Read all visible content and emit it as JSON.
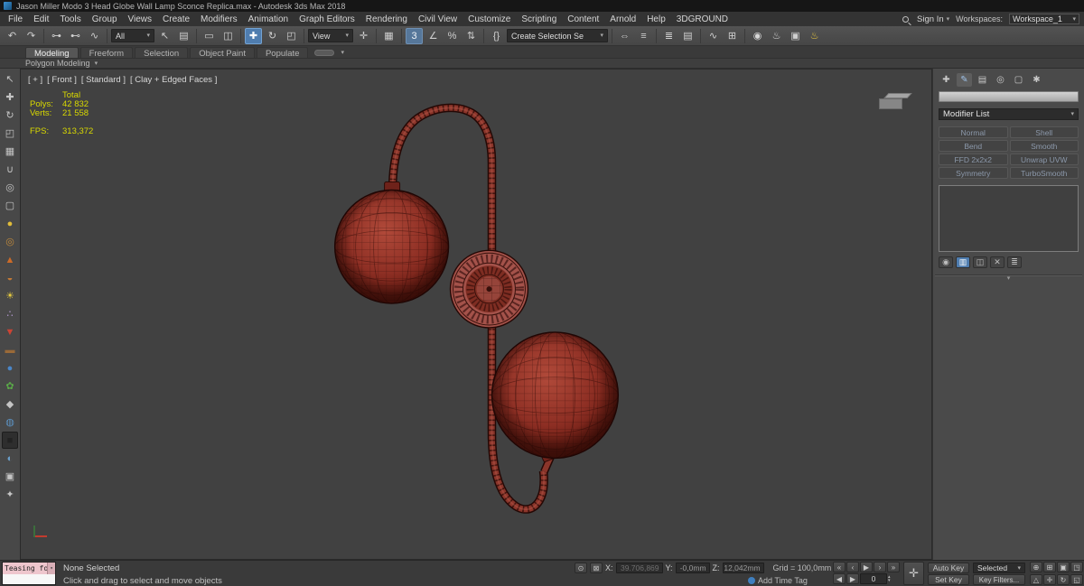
{
  "colors": {
    "accent_blue": "#4f7daf",
    "stats_yellow": "#d9d900",
    "globe_red": "#8a352a",
    "wire_dark": "#2a0906"
  },
  "title_bar": {
    "title": "Jason Miller Modo 3 Head Globe Wall Lamp Sconce Replica.max - Autodesk 3ds Max 2018"
  },
  "menu_bar": {
    "items": [
      "File",
      "Edit",
      "Tools",
      "Group",
      "Views",
      "Create",
      "Modifiers",
      "Animation",
      "Graph Editors",
      "Rendering",
      "Civil View",
      "Customize",
      "Scripting",
      "Content",
      "Arnold",
      "Help",
      "3DGROUND"
    ],
    "sign_in": "Sign In",
    "workspaces_label": "Workspaces:",
    "workspace_value": "Workspace_1"
  },
  "toolbar": {
    "filter_value": "All",
    "reference_value": "View",
    "named_sets_value": "Create Selection Se",
    "icons": {
      "undo": "↶",
      "redo": "↷",
      "link": "⊶",
      "unlink": "⊷",
      "bind": "∿",
      "select": "↖",
      "select_by_name": "▤",
      "region": "▭",
      "window_crossing": "◫",
      "move": "✚",
      "rotate": "↻",
      "scale": "◰",
      "manipulate": "✛",
      "keyboard": "▦",
      "snap": "3",
      "angle_snap": "∠",
      "percent_snap": "%",
      "spinner_snap": "⇅",
      "edit_sets": "{}",
      "mirror": "⇔",
      "align": "≡",
      "layers": "≣",
      "toggle_ribbon": "▤",
      "curve_editor": "∿",
      "schematic": "⊞",
      "material": "◉",
      "render_setup": "♨",
      "frame_window": "▣",
      "render": "♨"
    }
  },
  "ribbon": {
    "tabs": [
      "Modeling",
      "Freeform",
      "Selection",
      "Object Paint",
      "Populate"
    ],
    "panel_label": "Polygon Modeling"
  },
  "left_toolbar": {
    "icons": {
      "select": "↖",
      "move": "✚",
      "rotate": "↻",
      "scale": "◰",
      "grid": "▦",
      "magnet": "∪",
      "pivot": "◎",
      "box": "▢",
      "sphere": "●",
      "torus": "◎",
      "cone": "▲",
      "cup": "◒",
      "sun": "☀",
      "particles": "∴",
      "drop": "▼",
      "wood": "▬",
      "earth": "●",
      "leaf": "✿",
      "diamond": "◆",
      "water": "◍",
      "dark": "■",
      "globe": "◐",
      "box2": "▣",
      "star": "✦"
    }
  },
  "viewport": {
    "label_plus": "[ + ]",
    "label_view": "[ Front ]",
    "label_renderer": "[ Standard ]",
    "label_shading": "[ Clay + Edged Faces ]",
    "stats": {
      "total": "Total",
      "polys_label": "Polys:",
      "polys": "42 832",
      "verts_label": "Verts:",
      "verts": "21 558",
      "fps_label": "FPS:",
      "fps": "313,372"
    }
  },
  "command_panel": {
    "modifier_list": "Modifier List",
    "modifier_buttons": [
      "Normal",
      "Shell",
      "Bend",
      "Smooth",
      "FFD 2x2x2",
      "Unwrap UVW",
      "Symmetry",
      "TurboSmooth"
    ]
  },
  "status_bar": {
    "listener_text": "Teasing for",
    "status_line": "None Selected",
    "prompt_line": "Click and drag to select and move objects",
    "x_label": "X:",
    "x_value": "39.706,869",
    "y_label": "Y:",
    "y_value": "-0,0mm",
    "z_label": "Z:",
    "z_value": "12,042mm",
    "grid": "Grid = 100,0mm",
    "add_time_tag": "Add Time Tag",
    "auto_key": "Auto Key",
    "set_key": "Set Key",
    "selected": "Selected",
    "key_filters": "Key Filters...",
    "frame": "0"
  },
  "glyphs": {
    "misc": {
      "caret": "▾",
      "iso": "⊙",
      "lock": "⊠",
      "tag": "◔",
      "setkeys": "✛",
      "handle": "▾"
    },
    "pb": {
      "start": "«",
      "prev": "‹",
      "play": "▶",
      "next": "›",
      "end": "»",
      "fprev": "◀",
      "ffwd": "▶",
      "spin_up": "▴",
      "spin_down": "▾"
    },
    "nav": {
      "zoom": "⊕",
      "zoom_all": "⊞",
      "zoom_ext": "▣",
      "zoom_ext_all": "◳",
      "fov": "△",
      "pan": "✛",
      "orbit": "↻",
      "max": "◱"
    },
    "cp_tabs": {
      "create": "✚",
      "modify": "✎",
      "hierarchy": "▤",
      "motion": "◎",
      "display": "▢",
      "utilities": "✱"
    },
    "stack": {
      "pin": "◉",
      "show_end": "▥",
      "unique": "◫",
      "remove": "✕",
      "config": "≣"
    }
  }
}
